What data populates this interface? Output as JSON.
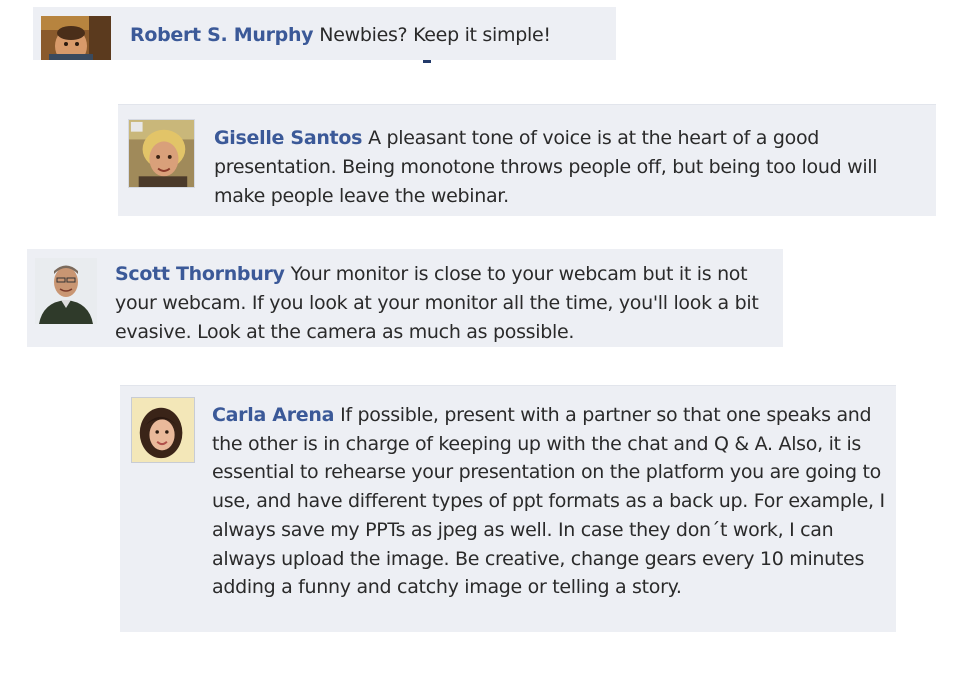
{
  "comments": [
    {
      "author": "Robert S. Murphy",
      "text": "Newbies? Keep it simple!",
      "avatar_icon": "profile-photo-icon"
    },
    {
      "author": "Giselle Santos",
      "text": "A pleasant tone of voice is at the heart of a good presentation. Being monotone throws people off, but being too loud will make people leave the webinar.",
      "avatar_icon": "profile-photo-icon"
    },
    {
      "author": "Scott Thornbury",
      "text": "Your monitor is close to your webcam but it is not your webcam. If you look at your monitor all the time, you'll look a bit evasive. Look at the camera as much as possible.",
      "avatar_icon": "profile-photo-icon"
    },
    {
      "author": "Carla Arena",
      "text": "If possible, present with a partner so that one speaks and the other is in charge of keeping up with the chat and Q & A. Also, it is essential to rehearse your presentation on the platform you are going to use, and have different types of ppt formats as a back up. For example, I always save my PPTs as jpeg as well. In case they don´t work, I can always upload the image. Be creative, change gears every 10 minutes adding a funny and catchy image or telling a story.",
      "avatar_icon": "profile-photo-icon"
    }
  ],
  "colors": {
    "author_link": "#3b5998",
    "comment_background": "#edeff4",
    "comment_text": "#2a2a2a"
  }
}
